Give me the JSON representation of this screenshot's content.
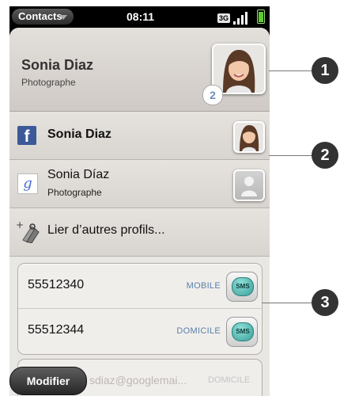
{
  "status_bar": {
    "app_menu_label": "Contacts",
    "time": "08:11",
    "network": "3G"
  },
  "header": {
    "name": "Sonia Diaz",
    "title": "Photographe",
    "profile_count": "2"
  },
  "profiles": [
    {
      "service": "facebook",
      "icon": "facebook-icon",
      "name": "Sonia Diaz"
    },
    {
      "service": "google",
      "icon": "google-icon",
      "name": "Sonia Díaz",
      "subtitle": "Photographe"
    }
  ],
  "link_profiles_label": "Lier d’autres profils...",
  "phones": [
    {
      "number": "55512340",
      "type": "MOBILE",
      "action": "SMS"
    },
    {
      "number": "55512344",
      "type": "DOMICILE",
      "action": "SMS"
    }
  ],
  "email": {
    "value": "sdiaz@googlemai...",
    "type": "DOMICILE"
  },
  "modify_button": "Modifier",
  "callouts": [
    "1",
    "2",
    "3"
  ],
  "colors": {
    "facebook": "#3b5998",
    "type_label": "#5b80aa",
    "sms_bubble": "#3a9f9b"
  }
}
